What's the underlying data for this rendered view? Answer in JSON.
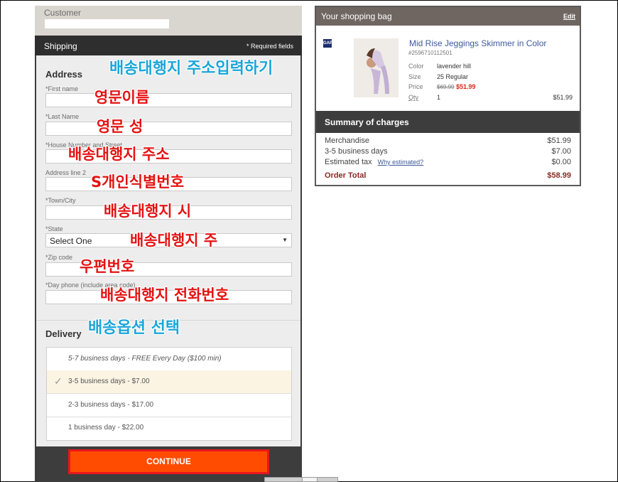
{
  "customer": {
    "label": "Customer"
  },
  "shipping": {
    "title": "Shipping",
    "required_note": "* Required fields"
  },
  "address": {
    "title": "Address",
    "fields": [
      {
        "label": "*First name"
      },
      {
        "label": "*Last Name"
      },
      {
        "label": "*House Number and Street"
      },
      {
        "label": "Address line 2"
      },
      {
        "label": "*Town/City"
      }
    ],
    "state": {
      "label": "*State",
      "value": "Select One"
    },
    "zip": {
      "label": "*Zip code"
    },
    "phone": {
      "label": "*Day phone (include area code)"
    }
  },
  "delivery": {
    "title": "Delivery",
    "options": [
      {
        "label": "5-7 business days - FREE Every Day ($100 min)",
        "selected": false
      },
      {
        "label": "3-5 business days - $7.00",
        "selected": true
      },
      {
        "label": "2-3 business days - $17.00",
        "selected": false
      },
      {
        "label": "1 business day - $22.00",
        "selected": false
      }
    ]
  },
  "continue_label": "CONTINUE",
  "annotations": {
    "address_heading": "배송대행지 주소입력하기",
    "first_name": "영문이름",
    "last_name": "영문 성",
    "street": "배송대행지 주소",
    "line2": "S개인식별번호",
    "city": "배송대행지 시",
    "state": "배송대행지 주",
    "zip": "우편번호",
    "phone": "배송대행지 전화번호",
    "delivery": "배송옵션 선택"
  },
  "bag": {
    "title": "Your shopping bag",
    "edit_label": "Edit",
    "brand_logo": "GAP",
    "item": {
      "name": "Mid Rise Jeggings Skimmer in Color",
      "sku": "#2596710112501",
      "color_label": "Color",
      "color": "lavender hill",
      "size_label": "Size",
      "size": "25 Regular",
      "price_label": "Price",
      "original_price": "$69.99",
      "sale_price": "$51.99",
      "qty_label": "Qty",
      "qty": "1",
      "line_total": "$51.99"
    }
  },
  "summary": {
    "title": "Summary of charges",
    "merchandise_label": "Merchandise",
    "merchandise": "$51.99",
    "shipping_label": "3-5 business days",
    "shipping": "$7.00",
    "tax_label": "Estimated tax",
    "tax_link": "Why estimated?",
    "tax": "$0.00",
    "total_label": "Order Total",
    "total": "$58.99"
  },
  "colors": {
    "continue_bg": "#ff4c00",
    "annotation_red": "#e41313",
    "annotation_blue": "#1aa6d9",
    "sale_red": "#e0261b"
  }
}
